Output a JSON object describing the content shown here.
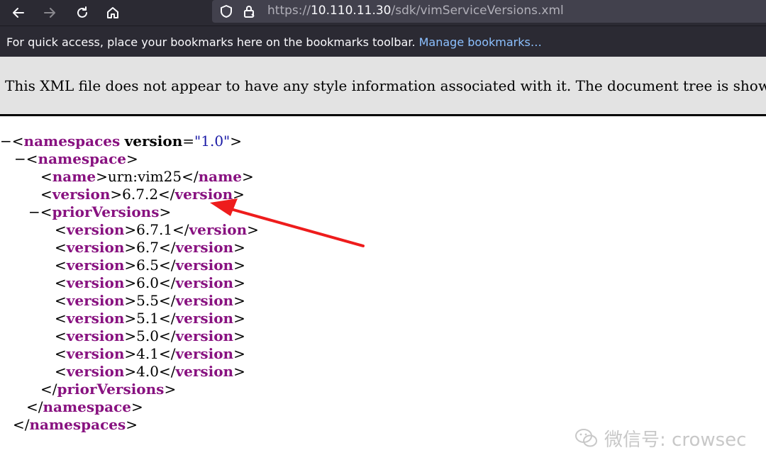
{
  "browser": {
    "url_prefix": "https://",
    "url_host": "10.110.11.30",
    "url_path": "/sdk/vimServiceVersions.xml",
    "bookmarks_hint": "For quick access, place your bookmarks here on the bookmarks toolbar.",
    "manage_bookmarks": "Manage bookmarks…",
    "icons": [
      "back-arrow-icon",
      "forward-arrow-icon",
      "reload-icon",
      "home-icon",
      "tracking-shield-icon",
      "lock-icon"
    ]
  },
  "xml_notice": "This XML file does not appear to have any style information associated with it. The document tree is shown below.",
  "xml": {
    "root_tag": "namespaces",
    "root_attr_name": "version",
    "root_attr_value": "\"1.0\"",
    "namespace_tag": "namespace",
    "name_tag": "name",
    "name_value": "urn:vim25",
    "version_tag": "version",
    "version_value": "6.7.2",
    "prior_tag": "priorVersions",
    "prior_versions": [
      "6.7.1",
      "6.7",
      "6.5",
      "6.0",
      "5.5",
      "5.1",
      "5.0",
      "4.1",
      "4.0"
    ],
    "expander": "−"
  },
  "annotation": {
    "arrow_color": "#ee1c1c"
  },
  "watermark": "微信号: crowsec",
  "colors": {
    "toolbar_bg": "#2b2a33",
    "urlbar_bg": "#42414d",
    "tag": "#881280",
    "attr_value": "#1a1aa6",
    "link": "#8cc0ff"
  }
}
